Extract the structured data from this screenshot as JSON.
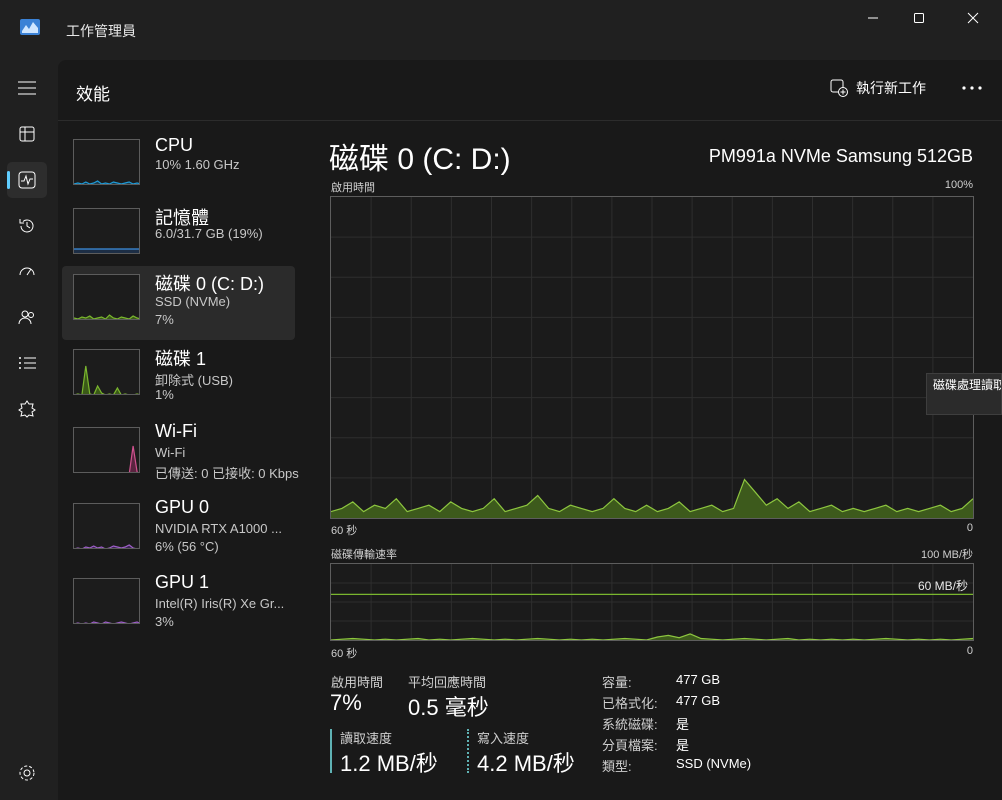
{
  "window": {
    "title": "工作管理員"
  },
  "header": {
    "page_title": "效能",
    "new_task_label": "執行新工作"
  },
  "rail": {
    "items": [
      {
        "name": "menu-icon"
      },
      {
        "name": "processes-icon"
      },
      {
        "name": "performance-icon"
      },
      {
        "name": "app-history-icon"
      },
      {
        "name": "startup-apps-icon"
      },
      {
        "name": "users-icon"
      },
      {
        "name": "details-icon"
      },
      {
        "name": "services-icon"
      },
      {
        "name": "settings-icon"
      }
    ]
  },
  "devices": [
    {
      "name": "CPU",
      "line1": "10%  1.60 GHz",
      "line2": "",
      "color": "#1f9bd8",
      "fill": "#1b3a4a"
    },
    {
      "name": "記憶體",
      "line1": "6.0/31.7 GB (19%)",
      "line2": "",
      "color": "#3d8fe0",
      "fill": "#1d2e45"
    },
    {
      "name": "磁碟 0 (C: D:)",
      "line1": "SSD (NVMe)",
      "line2": "7%",
      "color": "#7ab62e",
      "fill": "#3b5a18"
    },
    {
      "name": "磁碟 1",
      "line1": "卸除式 (USB)",
      "line2": "1%",
      "color": "#7ab62e",
      "fill": "#3b5a18"
    },
    {
      "name": "Wi-Fi",
      "line1": "Wi-Fi",
      "line2": "已傳送: 0 已接收: 0 Kbps",
      "color": "#d0528f",
      "fill": "#5a2440"
    },
    {
      "name": "GPU 0",
      "line1": "NVIDIA RTX A1000 ...",
      "line2": "6% (56 °C)",
      "color": "#9e5fc8",
      "fill": "#3a2550"
    },
    {
      "name": "GPU 1",
      "line1": "Intel(R) Iris(R) Xe Gr...",
      "line2": "3%",
      "color": "#9e5fc8",
      "fill": "#3a2550"
    }
  ],
  "detail": {
    "title": "磁碟 0 (C: D:)",
    "model": "PM991a NVMe Samsung 512GB",
    "chart1": {
      "label": "啟用時間",
      "max": "100%",
      "x_left": "60 秒",
      "x_right": "0"
    },
    "chart2": {
      "label": "磁碟傳輸速率",
      "max": "100 MB/秒",
      "ref_line": "60 MB/秒",
      "x_left": "60 秒",
      "x_right": "0"
    },
    "tooltip": "磁碟處理讀取比",
    "stats": {
      "active_time_label": "啟用時間",
      "active_time": "7%",
      "response_label": "平均回應時間",
      "response": "0.5 毫秒",
      "read_label": "讀取速度",
      "read": "1.2 MB/秒",
      "write_label": "寫入速度",
      "write": "4.2 MB/秒"
    },
    "props": [
      {
        "label": "容量:",
        "value": "477 GB"
      },
      {
        "label": "已格式化:",
        "value": "477 GB"
      },
      {
        "label": "系統磁碟:",
        "value": "是"
      },
      {
        "label": "分頁檔案:",
        "value": "是"
      },
      {
        "label": "類型:",
        "value": "SSD (NVMe)"
      }
    ]
  },
  "chart_data": {
    "type": "area",
    "charts": [
      {
        "label": "啟用時間",
        "ylim": [
          0,
          100
        ],
        "unit": "%",
        "values": [
          2,
          3,
          5,
          2,
          4,
          3,
          6,
          2,
          3,
          4,
          2,
          5,
          3,
          2,
          3,
          6,
          2,
          3,
          4,
          7,
          3,
          2,
          4,
          3,
          2,
          3,
          6,
          3,
          2,
          4,
          2,
          3,
          5,
          2,
          3,
          4,
          2,
          3,
          12,
          8,
          4,
          6,
          3,
          5,
          2,
          3,
          4,
          2,
          3,
          2,
          3,
          4,
          2,
          3,
          2,
          3,
          4,
          2,
          3,
          6
        ]
      },
      {
        "label": "磁碟傳輸速率",
        "ylim": [
          0,
          100
        ],
        "unit": "MB/秒",
        "values": [
          0,
          1,
          2,
          1,
          0,
          1,
          0,
          1,
          2,
          0,
          1,
          0,
          1,
          2,
          1,
          0,
          1,
          0,
          1,
          2,
          1,
          0,
          1,
          0,
          1,
          0,
          1,
          2,
          1,
          0,
          4,
          6,
          3,
          8,
          2,
          1,
          0,
          1,
          2,
          1,
          0,
          1,
          2,
          0,
          1,
          0,
          1,
          0,
          1,
          0,
          1,
          2,
          1,
          0,
          1,
          0,
          1,
          0,
          1,
          2
        ],
        "ref_line": 60
      }
    ]
  }
}
